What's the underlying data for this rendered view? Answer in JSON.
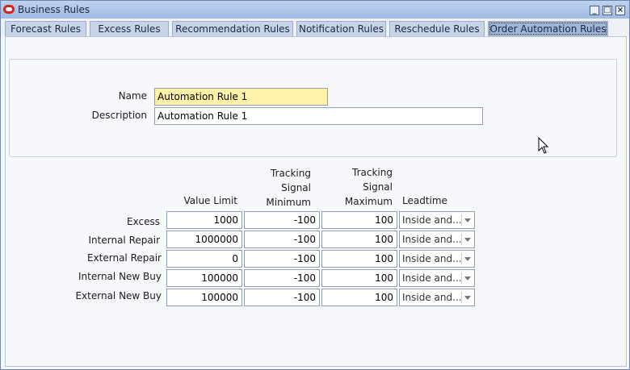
{
  "window": {
    "title": "Business Rules"
  },
  "tabs": [
    {
      "label": "Forecast Rules"
    },
    {
      "label": "Excess Rules"
    },
    {
      "label": "Recommendation Rules"
    },
    {
      "label": "Notification Rules"
    },
    {
      "label": "Reschedule Rules"
    },
    {
      "label": "Order Automation Rules"
    }
  ],
  "form": {
    "name_label": "Name",
    "name_value": "Automation Rule 1",
    "description_label": "Description",
    "description_value": "Automation Rule 1"
  },
  "table": {
    "columns": {
      "value_limit": "Value Limit",
      "tracking_min": [
        "Tracking",
        "Signal",
        "Minimum"
      ],
      "tracking_max": [
        "Tracking",
        "Signal",
        "Maximum"
      ],
      "leadtime": "Leadtime"
    },
    "rows": [
      {
        "label": "Excess",
        "value_limit": "1000",
        "min": "-100",
        "max": "100",
        "leadtime": "Inside and..."
      },
      {
        "label": "Internal Repair",
        "value_limit": "1000000",
        "min": "-100",
        "max": "100",
        "leadtime": "Inside and..."
      },
      {
        "label": "External Repair",
        "value_limit": "0",
        "min": "-100",
        "max": "100",
        "leadtime": "Inside and..."
      },
      {
        "label": "Internal New Buy",
        "value_limit": "100000",
        "min": "-100",
        "max": "100",
        "leadtime": "Inside and..."
      },
      {
        "label": "External New Buy",
        "value_limit": "100000",
        "min": "-100",
        "max": "100",
        "leadtime": "Inside and..."
      }
    ]
  },
  "icons": {
    "app": "oracle-icon",
    "minimize": "minimize-icon",
    "maximize": "maximize-icon",
    "close": "close-icon",
    "cursor": "mouse-pointer-icon"
  }
}
